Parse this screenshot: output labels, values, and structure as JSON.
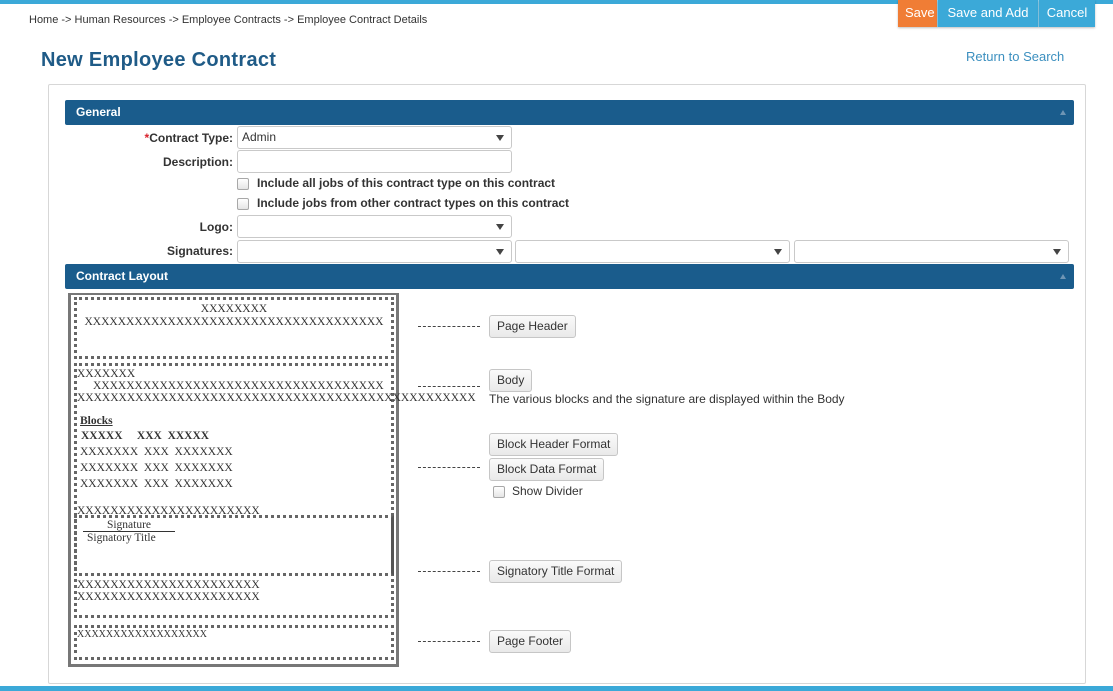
{
  "breadcrumb": "Home -> Human Resources -> Employee Contracts -> Employee Contract Details",
  "actions": {
    "save": "Save",
    "save_and_add": "Save and Add",
    "cancel": "Cancel"
  },
  "page": {
    "title": "New Employee Contract",
    "return_link": "Return to Search"
  },
  "general": {
    "header": "General",
    "contract_type_required": "*",
    "contract_type_label": "Contract Type:",
    "contract_type_value": "Admin",
    "description_label": "Description:",
    "description_value": "",
    "include_all_jobs_label": "Include all jobs of this contract type on this contract",
    "include_other_jobs_label": "Include jobs from other contract types on this contract",
    "logo_label": "Logo:",
    "logo_value": "",
    "signatures_label": "Signatures:",
    "signature_values": [
      "",
      "",
      ""
    ]
  },
  "layout": {
    "header": "Contract Layout",
    "preview": {
      "header_line1": "XXXXXXXX",
      "header_line2": "XXXXXXXXXXXXXXXXXXXXXXXXXXXXXXXXXXXX",
      "body_line1": "XXXXXXX",
      "body_line2": "XXXXXXXXXXXXXXXXXXXXXXXXXXXXXXXXXXX",
      "body_line3": "XXXXXXXXXXXXXXXXXXXXXXXXXXXXXXXXXXXXXXXXXXXXXXXX",
      "blocks_title": "Blocks",
      "blocks_header": "XXXXX     XXX  XXXXX",
      "blocks_rows": [
        "XXXXXXX  XXX  XXXXXXX",
        "XXXXXXX  XXX  XXXXXXX",
        "XXXXXXX  XXX  XXXXXXX"
      ],
      "body_line4": "XXXXXXXXXXXXXXXXXXXXXX",
      "signature_label": "Signature",
      "signatory_title": "Signatory Title",
      "after_sig_line1": "XXXXXXXXXXXXXXXXXXXXXX",
      "after_sig_line2": "XXXXXXXXXXXXXXXXXXXXXX",
      "footer_line": "XXXXXXXXXXXXXXXXXX"
    },
    "page_header_button": "Page Header",
    "body_button": "Body",
    "body_help": "The various blocks and the signature are displayed within the Body",
    "block_header_button": "Block Header Format",
    "block_data_button": "Block Data Format",
    "show_divider_label": "Show Divider",
    "signatory_title_button": "Signatory Title Format",
    "page_footer_button": "Page Footer"
  }
}
